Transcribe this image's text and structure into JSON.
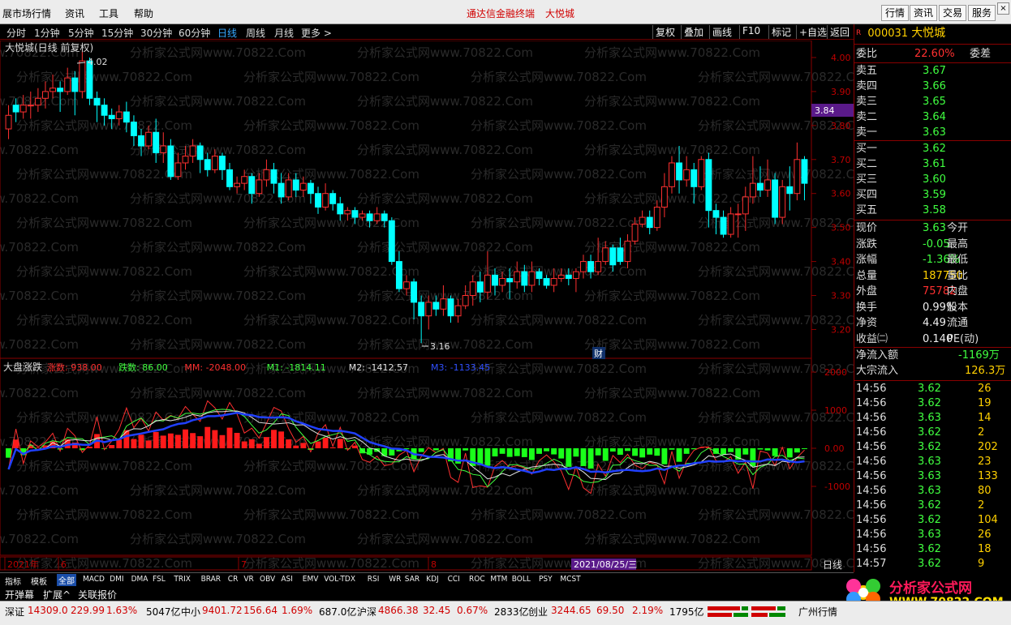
{
  "menu": {
    "items": [
      "展市场行情",
      "资讯",
      "工具",
      "帮助"
    ],
    "center_title": "通达信金融终端",
    "stock_title": "大悦城",
    "right_buttons": [
      "行情",
      "资讯",
      "交易",
      "服务"
    ]
  },
  "periods": {
    "items": [
      "分时",
      "1分钟",
      "5分钟",
      "15分钟",
      "30分钟",
      "60分钟",
      "日线",
      "周线",
      "月线",
      "更多 >"
    ],
    "active": "日线",
    "right_buttons": [
      "复权",
      "叠加",
      "画线",
      "F10",
      "标记",
      "+自选",
      "返回"
    ]
  },
  "kline": {
    "title": "大悦城(日线 前复权)",
    "high_label": "4.02",
    "low_label": "3.16",
    "price_label": "3.84",
    "event_marker": "财",
    "y_ticks": [
      "4.00",
      "3.90",
      "3.80",
      "3.70",
      "3.60",
      "3.50",
      "3.40",
      "3.30",
      "3.20"
    ],
    "ohlc": [
      [
        3.79,
        3.83,
        3.76,
        3.86
      ],
      [
        3.86,
        3.84,
        3.81,
        3.88
      ],
      [
        3.84,
        3.86,
        3.82,
        3.89
      ],
      [
        3.86,
        3.86,
        3.82,
        3.9
      ],
      [
        3.86,
        3.88,
        3.84,
        3.91
      ],
      [
        3.88,
        3.9,
        3.85,
        3.93
      ],
      [
        3.9,
        3.91,
        3.88,
        3.95
      ],
      [
        3.91,
        3.9,
        3.84,
        3.93
      ],
      [
        3.9,
        3.94,
        3.89,
        3.97
      ],
      [
        3.94,
        3.9,
        3.83,
        3.96
      ],
      [
        3.9,
        3.99,
        3.88,
        4.02
      ],
      [
        3.99,
        3.88,
        3.86,
        4.0
      ],
      [
        3.88,
        3.86,
        3.81,
        3.9
      ],
      [
        3.86,
        3.83,
        3.8,
        3.88
      ],
      [
        3.83,
        3.82,
        3.79,
        3.85
      ],
      [
        3.82,
        3.84,
        3.8,
        3.86
      ],
      [
        3.84,
        3.81,
        3.78,
        3.87
      ],
      [
        3.81,
        3.77,
        3.74,
        3.83
      ],
      [
        3.77,
        3.74,
        3.71,
        3.79
      ],
      [
        3.74,
        3.78,
        3.73,
        3.8
      ],
      [
        3.78,
        3.72,
        3.69,
        3.82
      ],
      [
        3.72,
        3.74,
        3.69,
        3.78
      ],
      [
        3.74,
        3.65,
        3.64,
        3.76
      ],
      [
        3.65,
        3.69,
        3.64,
        3.72
      ],
      [
        3.69,
        3.71,
        3.67,
        3.74
      ],
      [
        3.71,
        3.74,
        3.69,
        3.76
      ],
      [
        3.74,
        3.7,
        3.66,
        3.75
      ],
      [
        3.7,
        3.67,
        3.65,
        3.72
      ],
      [
        3.67,
        3.71,
        3.66,
        3.73
      ],
      [
        3.71,
        3.67,
        3.64,
        3.72
      ],
      [
        3.67,
        3.62,
        3.61,
        3.69
      ],
      [
        3.62,
        3.63,
        3.6,
        3.65
      ],
      [
        3.63,
        3.65,
        3.61,
        3.67
      ],
      [
        3.65,
        3.6,
        3.57,
        3.66
      ],
      [
        3.6,
        3.64,
        3.59,
        3.66
      ],
      [
        3.64,
        3.67,
        3.62,
        3.7
      ],
      [
        3.67,
        3.63,
        3.6,
        3.69
      ],
      [
        3.63,
        3.59,
        3.57,
        3.66
      ],
      [
        3.59,
        3.64,
        3.58,
        3.66
      ],
      [
        3.64,
        3.61,
        3.59,
        3.66
      ],
      [
        3.61,
        3.63,
        3.59,
        3.65
      ],
      [
        3.63,
        3.6,
        3.57,
        3.64
      ],
      [
        3.6,
        3.56,
        3.54,
        3.62
      ],
      [
        3.56,
        3.6,
        3.55,
        3.63
      ],
      [
        3.6,
        3.57,
        3.55,
        3.61
      ],
      [
        3.57,
        3.54,
        3.52,
        3.59
      ],
      [
        3.54,
        3.55,
        3.52,
        3.56
      ],
      [
        3.55,
        3.53,
        3.51,
        3.56
      ],
      [
        3.53,
        3.54,
        3.52,
        3.55
      ],
      [
        3.54,
        3.52,
        3.5,
        3.55
      ],
      [
        3.52,
        3.54,
        3.51,
        3.56
      ],
      [
        3.54,
        3.52,
        3.5,
        3.55
      ],
      [
        3.52,
        3.4,
        3.39,
        3.53
      ],
      [
        3.4,
        3.32,
        3.31,
        3.43
      ],
      [
        3.32,
        3.34,
        3.3,
        3.36
      ],
      [
        3.34,
        3.28,
        3.23,
        3.35
      ],
      [
        3.28,
        3.24,
        3.16,
        3.3
      ],
      [
        3.24,
        3.28,
        3.2,
        3.3
      ],
      [
        3.28,
        3.26,
        3.24,
        3.3
      ],
      [
        3.26,
        3.29,
        3.24,
        3.33
      ],
      [
        3.29,
        3.24,
        3.22,
        3.3
      ],
      [
        3.24,
        3.27,
        3.22,
        3.29
      ],
      [
        3.27,
        3.3,
        3.26,
        3.33
      ],
      [
        3.3,
        3.34,
        3.27,
        3.36
      ],
      [
        3.34,
        3.31,
        3.28,
        3.37
      ],
      [
        3.31,
        3.36,
        3.29,
        3.43
      ],
      [
        3.36,
        3.33,
        3.3,
        3.38
      ],
      [
        3.33,
        3.35,
        3.31,
        3.37
      ],
      [
        3.35,
        3.34,
        3.29,
        3.38
      ],
      [
        3.34,
        3.37,
        3.32,
        3.4
      ],
      [
        3.37,
        3.33,
        3.31,
        3.39
      ],
      [
        3.33,
        3.37,
        3.31,
        3.4
      ],
      [
        3.37,
        3.35,
        3.33,
        3.38
      ],
      [
        3.35,
        3.33,
        3.32,
        3.36
      ],
      [
        3.33,
        3.35,
        3.31,
        3.38
      ],
      [
        3.35,
        3.36,
        3.34,
        3.38
      ],
      [
        3.36,
        3.35,
        3.33,
        3.38
      ],
      [
        3.35,
        3.37,
        3.31,
        3.38
      ],
      [
        3.37,
        3.4,
        3.35,
        3.42
      ],
      [
        3.4,
        3.37,
        3.35,
        3.42
      ],
      [
        3.37,
        3.4,
        3.36,
        3.47
      ],
      [
        3.4,
        3.44,
        3.39,
        3.46
      ],
      [
        3.44,
        3.39,
        3.37,
        3.45
      ],
      [
        3.44,
        3.4,
        3.39,
        3.47
      ],
      [
        3.4,
        3.46,
        3.38,
        3.48
      ],
      [
        3.46,
        3.51,
        3.45,
        3.53
      ],
      [
        3.51,
        3.53,
        3.5,
        3.55
      ],
      [
        3.53,
        3.5,
        3.48,
        3.55
      ],
      [
        3.5,
        3.56,
        3.49,
        3.58
      ],
      [
        3.56,
        3.62,
        3.53,
        3.66
      ],
      [
        3.62,
        3.69,
        3.6,
        3.71
      ],
      [
        3.69,
        3.64,
        3.6,
        3.74
      ],
      [
        3.64,
        3.67,
        3.62,
        3.71
      ],
      [
        3.67,
        3.62,
        3.57,
        3.69
      ],
      [
        3.62,
        3.7,
        3.61,
        3.71
      ],
      [
        3.7,
        3.55,
        3.5,
        3.72
      ],
      [
        3.55,
        3.53,
        3.48,
        3.57
      ],
      [
        3.53,
        3.48,
        3.47,
        3.55
      ],
      [
        3.48,
        3.54,
        3.47,
        3.56
      ],
      [
        3.54,
        3.54,
        3.47,
        3.57
      ],
      [
        3.54,
        3.59,
        3.49,
        3.62
      ],
      [
        3.59,
        3.63,
        3.57,
        3.71
      ],
      [
        3.63,
        3.61,
        3.59,
        3.68
      ],
      [
        3.61,
        3.64,
        3.59,
        3.7
      ],
      [
        3.64,
        3.53,
        3.51,
        3.66
      ],
      [
        3.53,
        3.62,
        3.51,
        3.64
      ],
      [
        3.62,
        3.6,
        3.55,
        3.68
      ],
      [
        3.6,
        3.7,
        3.58,
        3.75
      ],
      [
        3.7,
        3.63,
        3.58,
        3.71
      ]
    ]
  },
  "volume_panel": {
    "name": "大盘涨跌",
    "legend": [
      {
        "label": "涨数: 938.00",
        "color": "#ff3030"
      },
      {
        "label": "跌数: 86.00",
        "color": "#40ff40"
      },
      {
        "label": "MM: -2048.00",
        "color": "#ff3030"
      },
      {
        "label": "M1: -1814.11",
        "color": "#40ff40"
      },
      {
        "label": "M2: -1412.57",
        "color": "#e0e0e0"
      },
      {
        "label": "M3: -1133.45",
        "color": "#3050ff"
      }
    ],
    "y_ticks": [
      "2000",
      "1000",
      "0.00",
      "-1000"
    ],
    "x_labels": [
      "2021年",
      "6",
      "7",
      "8"
    ],
    "date_cursor": "2021/08/25/三",
    "period_btn": "日线"
  },
  "quote": {
    "code": "000031",
    "name": "大悦城",
    "weibi_label": "委比",
    "weibi": "22.60%",
    "weicha_label": "委差",
    "sell": [
      [
        "卖五",
        "3.67"
      ],
      [
        "卖四",
        "3.66"
      ],
      [
        "卖三",
        "3.65"
      ],
      [
        "卖二",
        "3.64"
      ],
      [
        "卖一",
        "3.63"
      ]
    ],
    "buy": [
      [
        "买一",
        "3.62"
      ],
      [
        "买二",
        "3.61"
      ],
      [
        "买三",
        "3.60"
      ],
      [
        "买四",
        "3.59"
      ],
      [
        "买五",
        "3.58"
      ]
    ],
    "stats": [
      [
        "现价",
        "3.63",
        "今开"
      ],
      [
        "涨跌",
        "-0.05",
        "最高"
      ],
      [
        "涨幅",
        "-1.36%",
        "最低"
      ],
      [
        "总量",
        "187750",
        "量比"
      ],
      [
        "外盘",
        "75782",
        "内盘"
      ],
      [
        "换手",
        "0.99%",
        "股本"
      ],
      [
        "净资",
        "4.49",
        "流通"
      ],
      [
        "收益㈡",
        "0.140",
        "PE(动)"
      ]
    ],
    "net_inflow_label": "净流入额",
    "net_inflow": "-1169万",
    "block_inflow_label": "大宗流入",
    "block_inflow": "126.3万",
    "ticks": [
      [
        "14:56",
        "3.62",
        "26"
      ],
      [
        "14:56",
        "3.62",
        "19"
      ],
      [
        "14:56",
        "3.63",
        "14"
      ],
      [
        "14:56",
        "3.62",
        "2"
      ],
      [
        "14:56",
        "3.62",
        "202"
      ],
      [
        "14:56",
        "3.63",
        "23"
      ],
      [
        "14:56",
        "3.63",
        "133"
      ],
      [
        "14:56",
        "3.63",
        "80"
      ],
      [
        "14:56",
        "3.62",
        "2"
      ],
      [
        "14:56",
        "3.62",
        "104"
      ],
      [
        "14:56",
        "3.63",
        "26"
      ],
      [
        "14:56",
        "3.62",
        "18"
      ],
      [
        "14:57",
        "3.62",
        "9"
      ]
    ]
  },
  "indicator_tabs": {
    "items": [
      "指标",
      "模板",
      "全部",
      "MACD",
      "DMI",
      "DMA",
      "FSL",
      "TRIX",
      "BRAR",
      "CR",
      "VR",
      "OBV",
      "ASI",
      "EMV",
      "VOL-TDX",
      "RSI",
      "WR",
      "SAR",
      "KDJ",
      "CCI",
      "ROC",
      "MTM",
      "BOLL",
      "PSY",
      "MCST"
    ],
    "active": "全部",
    "row2": [
      "开弹幕",
      "扩展^",
      "关联报价"
    ]
  },
  "status": {
    "sz_label": "深证",
    "sz": "14309.0",
    "sz_chg": "229.99",
    "sz_pct": "1.63%",
    "sz_amt": "5047亿",
    "zx_label": "中小",
    "zx": "9401.72",
    "zx_chg": "156.64",
    "zx_pct": "1.69%",
    "zx_amt": "687.0亿",
    "sh_label": "沪深",
    "sh": "4866.38",
    "sh_chg": "32.45",
    "sh_pct": "0.67%",
    "sh_amt": "2833亿",
    "cy_label": "创业",
    "cy": "3244.65",
    "cy_chg": "69.50",
    "cy_pct": "2.19%",
    "cy_amt": "1795亿",
    "right": "广州行情"
  },
  "logo": {
    "text": "分析家公式网",
    "url": "WWW.70822.COM"
  },
  "watermark": "分析家公式网www.70822.Com",
  "colors": {
    "up": "#ff3030",
    "down": "#00ffff",
    "grid": "#8a0000",
    "accent": "#36a8ff"
  }
}
